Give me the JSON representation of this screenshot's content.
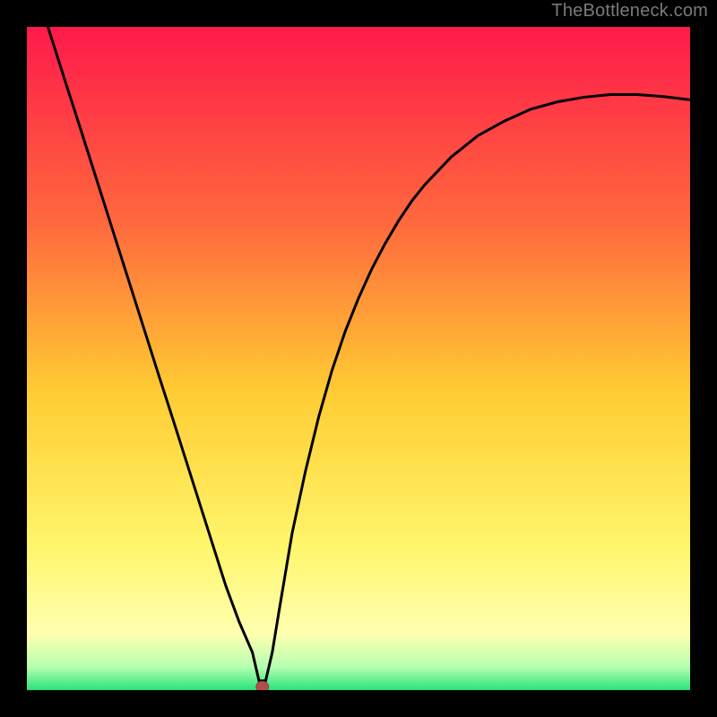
{
  "watermark": "TheBottleneck.com",
  "colors": {
    "frame": "#000000",
    "curve": "#000000",
    "marker_fill": "#b04f4e",
    "marker_stroke": "#9a3d3c",
    "gradient_stops": [
      {
        "pct": 0.0,
        "color": "#ff1a4b"
      },
      {
        "pct": 0.3,
        "color": "#ff6a3d"
      },
      {
        "pct": 0.55,
        "color": "#ffcc33"
      },
      {
        "pct": 0.78,
        "color": "#fff56a"
      },
      {
        "pct": 0.915,
        "color": "#ffffb0"
      },
      {
        "pct": 0.965,
        "color": "#b6ffb0"
      },
      {
        "pct": 1.0,
        "color": "#29e27a"
      }
    ]
  },
  "chart_data": {
    "type": "line",
    "title": "",
    "xlabel": "",
    "ylabel": "",
    "x": [
      0.0,
      0.02,
      0.04,
      0.06,
      0.08,
      0.1,
      0.12,
      0.14,
      0.16,
      0.18,
      0.2,
      0.22,
      0.24,
      0.26,
      0.28,
      0.3,
      0.32,
      0.34,
      0.35,
      0.36,
      0.37,
      0.38,
      0.4,
      0.42,
      0.44,
      0.46,
      0.48,
      0.5,
      0.52,
      0.54,
      0.56,
      0.58,
      0.6,
      0.64,
      0.68,
      0.72,
      0.76,
      0.8,
      0.84,
      0.88,
      0.92,
      0.96,
      1.0
    ],
    "values": [
      1.1,
      1.037,
      0.974,
      0.911,
      0.849,
      0.786,
      0.723,
      0.66,
      0.597,
      0.534,
      0.471,
      0.409,
      0.346,
      0.283,
      0.22,
      0.157,
      0.103,
      0.057,
      0.014,
      0.014,
      0.057,
      0.118,
      0.237,
      0.33,
      0.412,
      0.482,
      0.541,
      0.591,
      0.635,
      0.673,
      0.707,
      0.737,
      0.762,
      0.804,
      0.836,
      0.858,
      0.876,
      0.887,
      0.894,
      0.898,
      0.898,
      0.895,
      0.89
    ],
    "xlim": [
      0,
      1
    ],
    "ylim": [
      0,
      1
    ],
    "grid": false,
    "marker": {
      "x": 0.355,
      "y": 0.005
    }
  }
}
